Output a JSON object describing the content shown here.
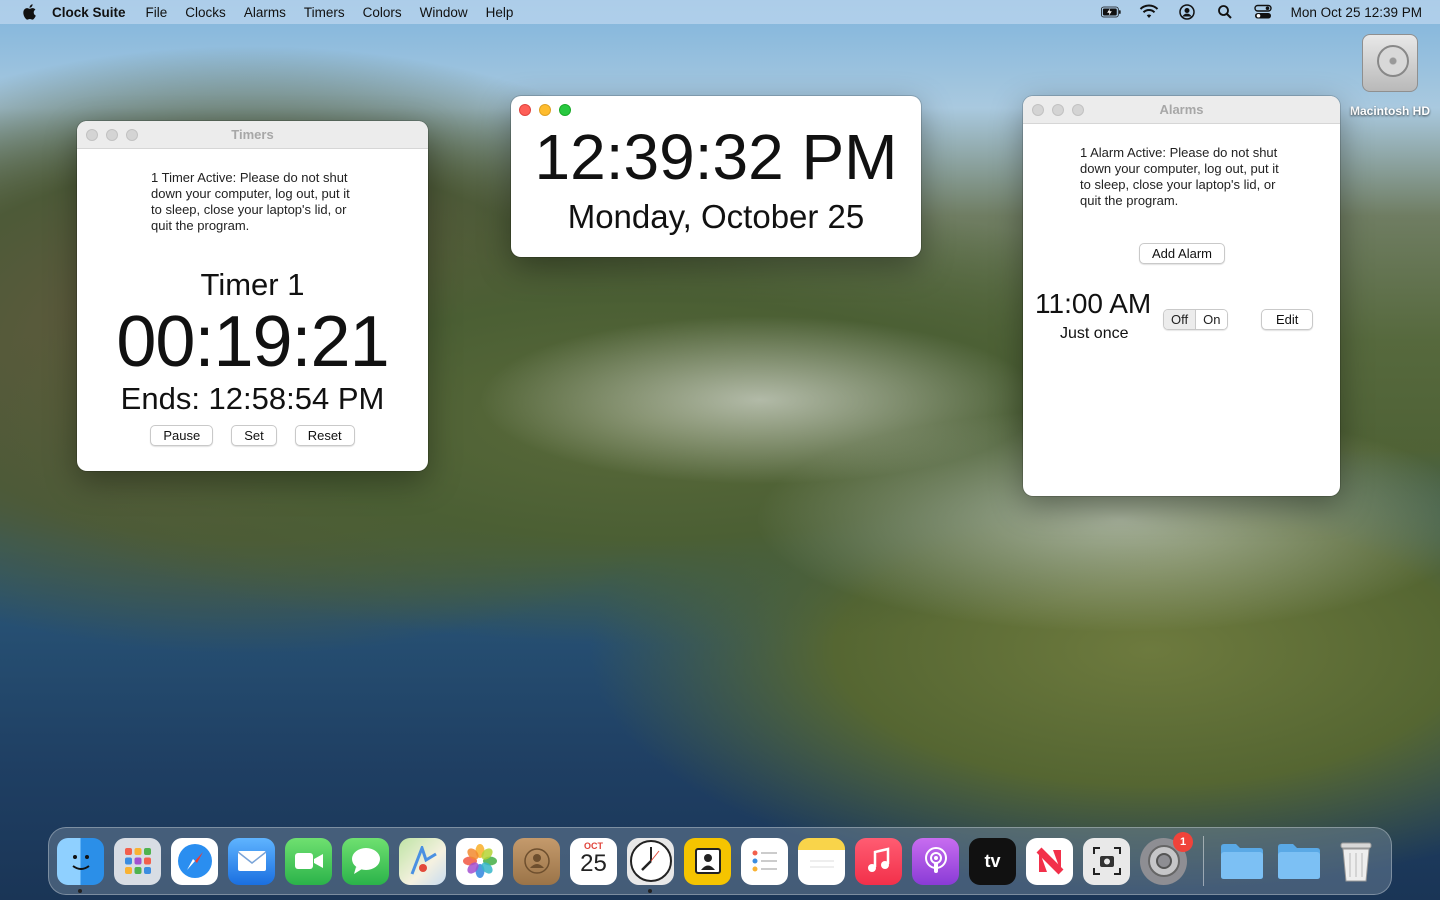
{
  "menubar": {
    "app_name": "Clock Suite",
    "menus": [
      "File",
      "Clocks",
      "Alarms",
      "Timers",
      "Colors",
      "Window",
      "Help"
    ],
    "datetime": "Mon Oct 25  12:39 PM"
  },
  "desktop": {
    "disk_label": "Macintosh HD"
  },
  "timers_window": {
    "title": "Timers",
    "warning": "1 Timer Active: Please do not shut down your computer, log out, put it to sleep, close your laptop's lid, or quit the program.",
    "timer_name": "Timer 1",
    "remaining": "00:19:21",
    "ends": "Ends: 12:58:54 PM",
    "pause_label": "Pause",
    "set_label": "Set",
    "reset_label": "Reset"
  },
  "clock_window": {
    "time": "12:39:32 PM",
    "date": "Monday, October 25"
  },
  "alarms_window": {
    "title": "Alarms",
    "warning": "1 Alarm Active: Please do not shut down your computer, log out, put it to sleep, close your laptop's lid, or quit the program.",
    "add_label": "Add Alarm",
    "alarm_time": "11:00 AM",
    "repeat": "Just once",
    "off_label": "Off",
    "on_label": "On",
    "selected_state": "On",
    "edit_label": "Edit"
  },
  "dock": {
    "calendar_month": "OCT",
    "calendar_day": "25",
    "tv_label": "tv",
    "settings_badge": "1",
    "items": [
      "finder-icon",
      "launchpad-icon",
      "safari-icon",
      "mail-icon",
      "facetime-icon",
      "messages-icon",
      "maps-icon",
      "photos-icon",
      "contacts-icon",
      "calendar-icon",
      "clock-icon",
      "preview-icon",
      "reminders-icon",
      "notes-icon",
      "music-icon",
      "podcasts-icon",
      "tv-icon",
      "news-icon",
      "screenshot-icon",
      "system-preferences-icon",
      "folder-icon",
      "folder-icon",
      "trash-icon"
    ]
  }
}
